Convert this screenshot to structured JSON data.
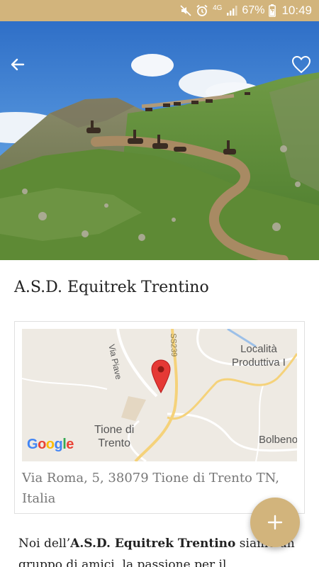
{
  "status_bar": {
    "battery_percent": "67%",
    "network": "4G",
    "time": "10:49",
    "icons": [
      "mute-icon",
      "alarm-icon",
      "signal-icon",
      "battery-icon"
    ]
  },
  "header": {
    "back_icon": "arrow-left-icon",
    "favorite_icon": "heart-outline-icon"
  },
  "title": "A.S.D. Equitrek Trentino",
  "map": {
    "labels": {
      "via_piave": "Via Piave",
      "ss239": "SS239",
      "localita_line1": "Località",
      "localita_line2": "Produttiva I",
      "tione_line1": "Tione di",
      "tione_line2": "Trento",
      "bolbeno": "Bolbeno"
    },
    "provider": "Google"
  },
  "address": "Via Roma, 5, 38079 Tione di Trento TN, Italia",
  "description": {
    "prefix": "Noi dell’",
    "org": "A.S.D. Equitrek Trentino",
    "suffix": " siamo un gruppo di amici, la passione per il"
  },
  "fab": {
    "label": "+",
    "icon": "plus-icon"
  },
  "colors": {
    "accent": "#d2b47c",
    "map_road": "#f5d27a",
    "pin": "#e53935"
  }
}
